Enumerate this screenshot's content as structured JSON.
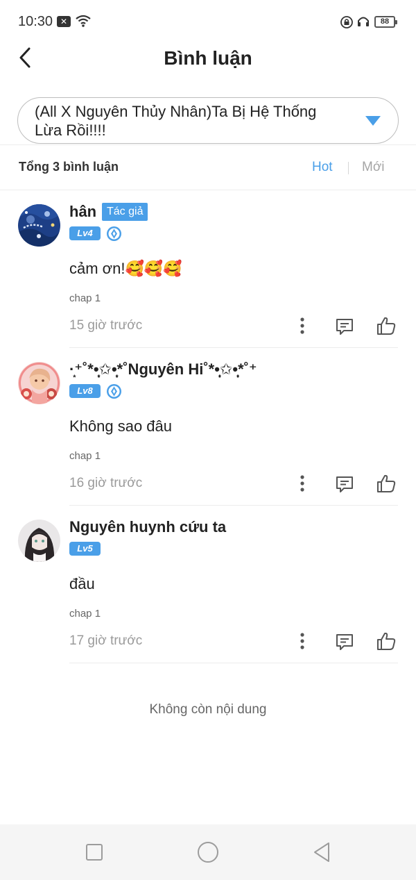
{
  "status_bar": {
    "time": "10:30",
    "notification_glyph": "✕",
    "battery": "88"
  },
  "header": {
    "title": "Bình luận"
  },
  "chapter_selector": {
    "title": "(All X Nguyên Thủy Nhân)Ta Bị Hệ Thống Lừa Rồi!!!!"
  },
  "summary": {
    "total": "Tổng 3 bình luận",
    "tab_hot": "Hot",
    "tab_new": "Mới"
  },
  "comments": [
    {
      "user": "hân",
      "author_badge": "Tác giả",
      "level": "Lv4",
      "text": "cảm ơn!🥰🥰🥰",
      "chapter": "chap 1",
      "time": "15 giờ trước"
    },
    {
      "user": "·͙⁺˚*•̩̩͙✩•̩̩͙*˚Nguyên Hi˚*•̩̩͙✩•̩̩͙*˚⁺",
      "level": "Lv8",
      "text": "Không sao đâu",
      "chapter": "chap 1",
      "time": "16 giờ trước"
    },
    {
      "user": "Nguyên huynh cứu ta",
      "level": "Lv5",
      "text": "đầu",
      "chapter": "chap 1",
      "time": "17 giờ trước"
    }
  ],
  "footer": {
    "end_text": "Không còn nội dung"
  },
  "colors": {
    "accent": "#4a9fe8",
    "text": "#222222",
    "muted": "#9a9a9a"
  }
}
